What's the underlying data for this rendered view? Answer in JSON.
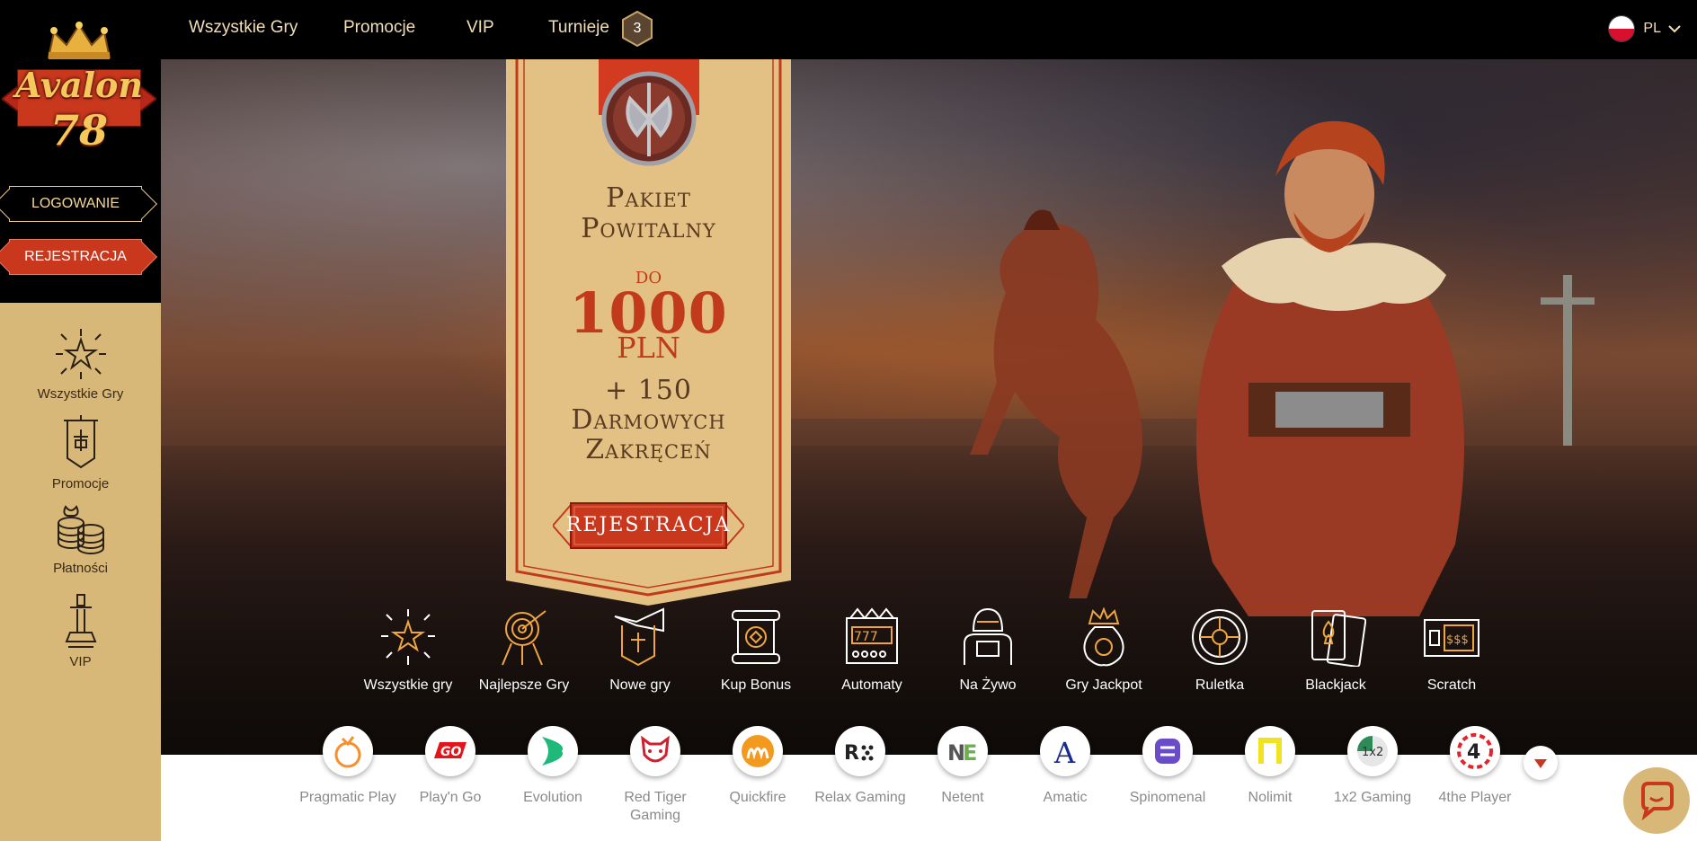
{
  "brand": {
    "name": "Avalon",
    "number": "78"
  },
  "auth": {
    "login_label": "LOGOWANIE",
    "register_label": "REJESTRACJA"
  },
  "sidebar": {
    "items": [
      {
        "label": "Wszystkie Gry",
        "icon": "star-burst-icon"
      },
      {
        "label": "Promocje",
        "icon": "banner-icon"
      },
      {
        "label": "Płatności",
        "icon": "coins-icon"
      },
      {
        "label": "VIP",
        "icon": "sword-icon"
      }
    ]
  },
  "topnav": {
    "items": [
      {
        "label": "Wszystkie Gry"
      },
      {
        "label": "Promocje"
      },
      {
        "label": "VIP"
      },
      {
        "label": "Turnieje"
      }
    ],
    "tournament_badge": "3",
    "language": "PL"
  },
  "promo": {
    "title_line1": "Pakiet",
    "title_line2": "Powitalny",
    "prefix": "do",
    "amount": "1000",
    "currency": "PLN",
    "spins_line1": "+ 150",
    "spins_line2": "Darmowych",
    "spins_line3": "Zakręceń",
    "button_label": "REJESTRACJA"
  },
  "categories": [
    {
      "label": "Wszystkie gry",
      "icon": "star-burst-icon"
    },
    {
      "label": "Najlepsze Gry",
      "icon": "target-icon"
    },
    {
      "label": "Nowe gry",
      "icon": "horn-icon"
    },
    {
      "label": "Kup Bonus",
      "icon": "scroll-icon"
    },
    {
      "label": "Automaty",
      "icon": "slot-machine-icon"
    },
    {
      "label": "Na Żywo",
      "icon": "knight-icon"
    },
    {
      "label": "Gry Jackpot",
      "icon": "crown-bag-icon"
    },
    {
      "label": "Ruletka",
      "icon": "roulette-icon"
    },
    {
      "label": "Blackjack",
      "icon": "cards-icon"
    },
    {
      "label": "Scratch",
      "icon": "scratch-card-icon"
    }
  ],
  "providers": [
    {
      "label": "Pragmatic Play",
      "icon": "pragmatic-logo-icon",
      "color": "#f5902d"
    },
    {
      "label": "Play'n Go",
      "icon": "playngo-logo-icon",
      "color": "#e3151b"
    },
    {
      "label": "Evolution",
      "icon": "evolution-logo-icon",
      "color": "#1fb97a"
    },
    {
      "label": "Red Tiger Gaming",
      "icon": "red-tiger-logo-icon",
      "color": "#d0202d"
    },
    {
      "label": "Quickfire",
      "icon": "quickfire-logo-icon",
      "color": "#f39a1e"
    },
    {
      "label": "Relax Gaming",
      "icon": "relax-logo-icon",
      "color": "#222222"
    },
    {
      "label": "Netent",
      "icon": "netent-logo-icon",
      "color": "#6ab04c"
    },
    {
      "label": "Amatic",
      "icon": "amatic-logo-icon",
      "color": "#1a2a8a"
    },
    {
      "label": "Spinomenal",
      "icon": "spinomenal-logo-icon",
      "color": "#6a4cc8"
    },
    {
      "label": "Nolimit",
      "icon": "nolimit-logo-icon",
      "color": "#f1e320"
    },
    {
      "label": "1x2 Gaming",
      "icon": "1x2-logo-icon",
      "color": "#2e8b57"
    },
    {
      "label": "4the Player",
      "icon": "4theplayer-logo-icon",
      "color": "#e2252d"
    }
  ],
  "colors": {
    "accent": "#c9371d",
    "gold": "#d8b878",
    "dark": "#000000"
  }
}
